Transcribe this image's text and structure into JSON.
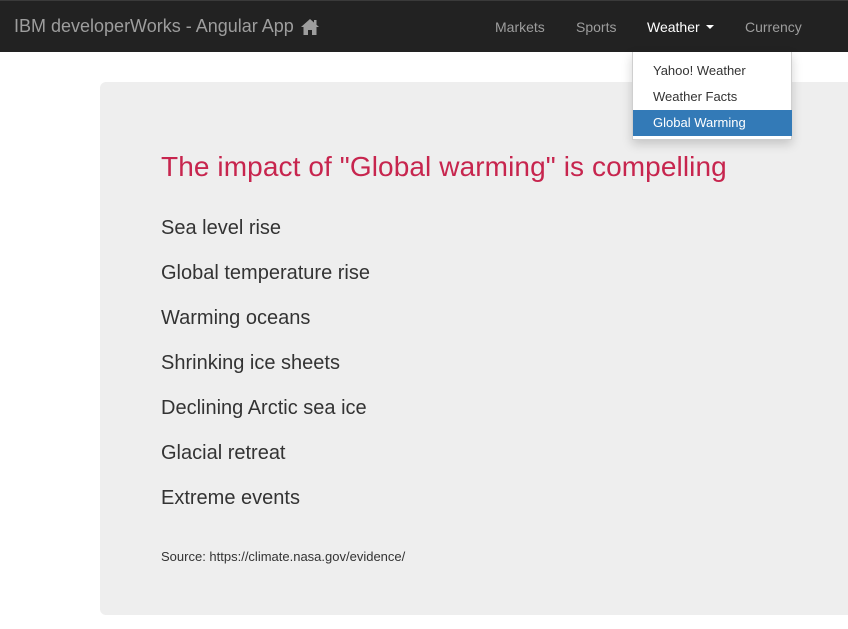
{
  "navbar": {
    "brand": "IBM developerWorks - Angular App",
    "brand_icon": "home-icon",
    "links": {
      "markets": "Markets",
      "sports": "Sports",
      "weather": "Weather",
      "currency": "Currency"
    },
    "active_link": "Weather"
  },
  "weather_dropdown": {
    "items": [
      "Yahoo! Weather",
      "Weather Facts",
      "Global Warming"
    ],
    "selected": "Global Warming"
  },
  "main": {
    "heading": "The impact of \"Global warming\" is compelling",
    "facts": [
      "Sea level rise",
      "Global temperature rise",
      "Warming oceans",
      "Shrinking ice sheets",
      "Declining Arctic sea ice",
      "Glacial retreat",
      "Extreme events"
    ],
    "source": "Source: https://climate.nasa.gov/evidence/"
  },
  "colors": {
    "navbar_bg": "#222222",
    "nav_text": "#9d9d9d",
    "active_text": "#ffffff",
    "selected_item_bg": "#337ab7",
    "heading": "#c7254e",
    "panel_bg": "#eeeeee"
  }
}
